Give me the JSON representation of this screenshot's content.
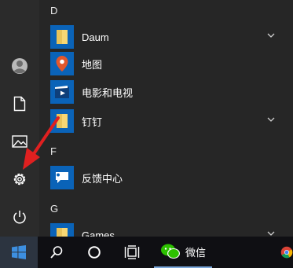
{
  "start_menu": {
    "sections": [
      {
        "letter": "D",
        "apps": [
          {
            "name": "Daum",
            "icon": "folder-icon",
            "expandable": true
          },
          {
            "name": "地图",
            "icon": "map-pin-icon",
            "expandable": false
          },
          {
            "name": "电影和电视",
            "icon": "video-play-icon",
            "expandable": false
          },
          {
            "name": "钉钉",
            "icon": "folder-icon",
            "expandable": true
          }
        ]
      },
      {
        "letter": "F",
        "apps": [
          {
            "name": "反馈中心",
            "icon": "feedback-icon",
            "expandable": false
          }
        ]
      },
      {
        "letter": "G",
        "apps": [
          {
            "name": "Games",
            "icon": "folder-icon",
            "expandable": true
          }
        ]
      }
    ],
    "left_rail": [
      "user-avatar-icon",
      "documents-icon",
      "pictures-icon",
      "settings-icon",
      "power-icon"
    ]
  },
  "taskbar": {
    "items": [
      "windows-start-icon",
      "search-icon",
      "cortana-icon",
      "task-view-icon",
      "wechat-icon",
      "chrome-icon"
    ],
    "wechat_label": "微信"
  },
  "colors": {
    "tile": "#0a63b8",
    "folder": "#f7d774",
    "arrow": "#e02020",
    "menu_bg": "#262626",
    "taskbar_bg": "#0f0f13"
  }
}
